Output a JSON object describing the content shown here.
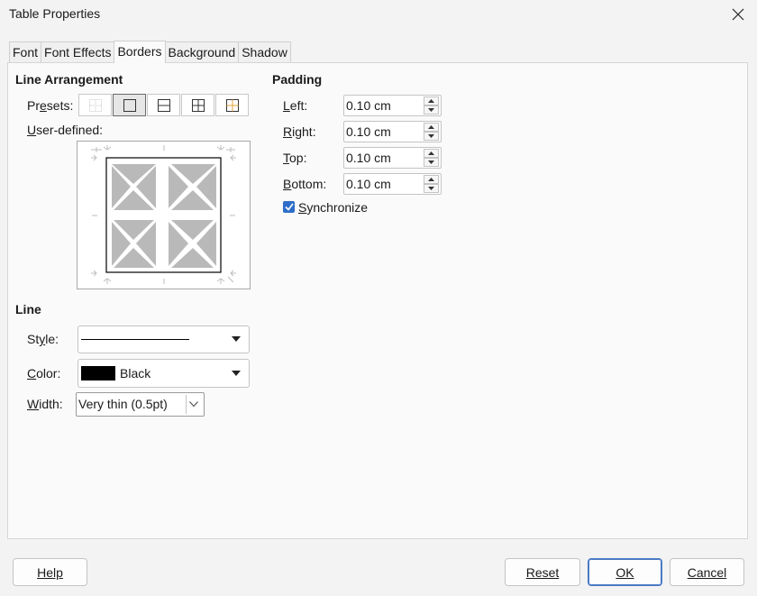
{
  "window": {
    "title": "Table Properties"
  },
  "tabs": [
    "Font",
    "Font Effects",
    "Borders",
    "Background",
    "Shadow"
  ],
  "active_tab": "Borders",
  "line_arrangement": {
    "heading": "Line Arrangement",
    "presets_label": "Presets:",
    "user_defined_label": "User-defined:"
  },
  "line": {
    "heading": "Line",
    "style_label": "Style:",
    "color_label": "Color:",
    "color_value": "Black",
    "color_swatch": "#000000",
    "width_label": "Width:",
    "width_value": "Very thin (0.5pt)"
  },
  "padding": {
    "heading": "Padding",
    "fields": [
      {
        "label": "Left:",
        "value": "0.10 cm"
      },
      {
        "label": "Right:",
        "value": "0.10 cm"
      },
      {
        "label": "Top:",
        "value": "0.10 cm"
      },
      {
        "label": "Bottom:",
        "value": "0.10 cm"
      }
    ],
    "synchronize_label": "Synchronize",
    "synchronize_checked": true
  },
  "buttons": {
    "help": "Help",
    "reset": "Reset",
    "ok": "OK",
    "cancel": "Cancel"
  },
  "colors": {
    "accent": "#2f6ec8",
    "panel_bg": "#fafafa"
  }
}
